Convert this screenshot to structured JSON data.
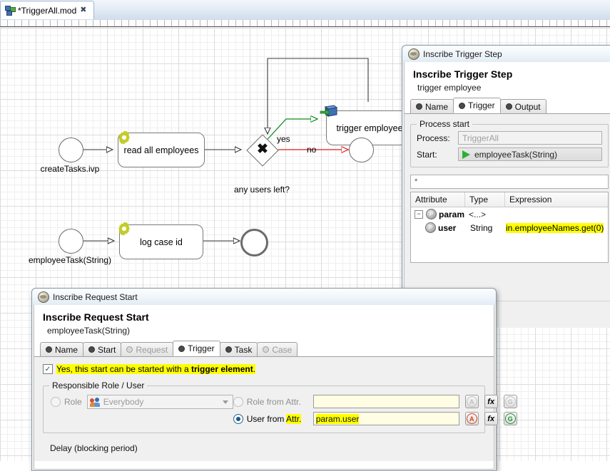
{
  "editor": {
    "tab_label": "*TriggerAll.mod",
    "tab_icon": "process-model-icon",
    "close_icon": "close-tab-icon"
  },
  "diagram": {
    "nodes": [
      {
        "id": "start1",
        "type": "start-event",
        "label": "createTasks.ivp"
      },
      {
        "id": "read-all-employees",
        "type": "script-activity",
        "label": "read all employees"
      },
      {
        "id": "any-users-left",
        "type": "exclusive-gateway",
        "label": "any users left?"
      },
      {
        "id": "trigger-employee",
        "type": "trigger-activity",
        "label": "trigger employee"
      },
      {
        "id": "end1",
        "type": "end-event",
        "label": ""
      },
      {
        "id": "start2",
        "type": "start-event",
        "label": "employeeTask(String)"
      },
      {
        "id": "log-case-id",
        "type": "script-activity",
        "label": "log case id"
      },
      {
        "id": "end2",
        "type": "end-event",
        "label": ""
      }
    ],
    "edge_labels": {
      "yes": "yes",
      "no": "no"
    }
  },
  "trigger_dialog": {
    "window_title": "Inscribe Trigger Step",
    "heading": "Inscribe Trigger Step",
    "subheading": "trigger employee",
    "tabs": [
      {
        "label": "Name",
        "selected": false,
        "enabled": true
      },
      {
        "label": "Trigger",
        "selected": true,
        "enabled": true
      },
      {
        "label": "Output",
        "selected": false,
        "enabled": true
      }
    ],
    "group_title": "Process start",
    "process_label": "Process:",
    "process_value": "TriggerAll",
    "start_label": "Start:",
    "start_value": "employeeTask(String)",
    "filter_value": "*",
    "table": {
      "columns": [
        "Attribute",
        "Type",
        "Expression"
      ],
      "rows": [
        {
          "attribute": "param",
          "type": "<...>",
          "expression": "",
          "level": 0,
          "expanded": true,
          "highlight": false
        },
        {
          "attribute": "user",
          "type": "String",
          "expression": "in.employeeNames.get(0)",
          "level": 1,
          "expanded": false,
          "highlight": true
        }
      ]
    },
    "help_label": "?"
  },
  "request_dialog": {
    "window_title": "Inscribe Request Start",
    "heading": "Inscribe Request Start",
    "subheading": "employeeTask(String)",
    "tabs": [
      {
        "label": "Name",
        "selected": false,
        "enabled": true
      },
      {
        "label": "Start",
        "selected": false,
        "enabled": true
      },
      {
        "label": "Request",
        "selected": false,
        "enabled": false
      },
      {
        "label": "Trigger",
        "selected": true,
        "enabled": true
      },
      {
        "label": "Task",
        "selected": false,
        "enabled": true
      },
      {
        "label": "Case",
        "selected": false,
        "enabled": false
      }
    ],
    "trigger_checkbox": {
      "checked": true,
      "text_before": "Yes, this start can be started with a ",
      "text_bold": "trigger element",
      "text_after": "."
    },
    "responsible_group_title": "Responsible Role / User",
    "role_radio_label": "Role",
    "role_combo_value": "Everybody",
    "role_from_attr_label": "Role from Attr.",
    "role_from_attr_value": "",
    "user_from_attr_label_1": "User from ",
    "user_from_attr_label_2": "Attr.",
    "user_from_attr_value": "param.user",
    "role_from_attr_selected": false,
    "user_from_attr_selected": true,
    "buttons": {
      "attr": "A",
      "fx": "fx",
      "refresh": "G"
    },
    "delay_group_title": "Delay (blocking period)"
  },
  "colors": {
    "highlight": "#ffff00",
    "gear": "#c3cc28",
    "trigger_box": "#3f6fb5",
    "yes_edge": "#0b8a1c",
    "no_edge": "#e02020",
    "field_yellow": "#fffde3"
  }
}
